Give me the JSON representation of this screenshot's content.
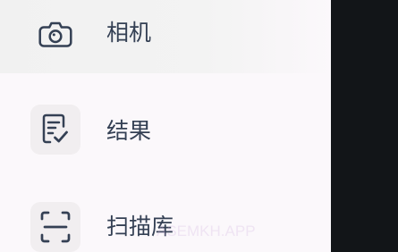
{
  "drawer": {
    "items": [
      {
        "label": "相机",
        "icon": "camera-icon",
        "selected": true
      },
      {
        "label": "结果",
        "icon": "document-check-icon",
        "selected": false
      },
      {
        "label": "扫描库",
        "icon": "scan-frame-icon",
        "selected": false
      }
    ]
  },
  "watermark": {
    "text": "ASEMKH.APP"
  },
  "colors": {
    "drawer_background": "#fbf8fb",
    "selected_background": "#f1f1f1",
    "icon_tile": "#f1eef0",
    "text": "#344054",
    "scrim": "#121518"
  }
}
